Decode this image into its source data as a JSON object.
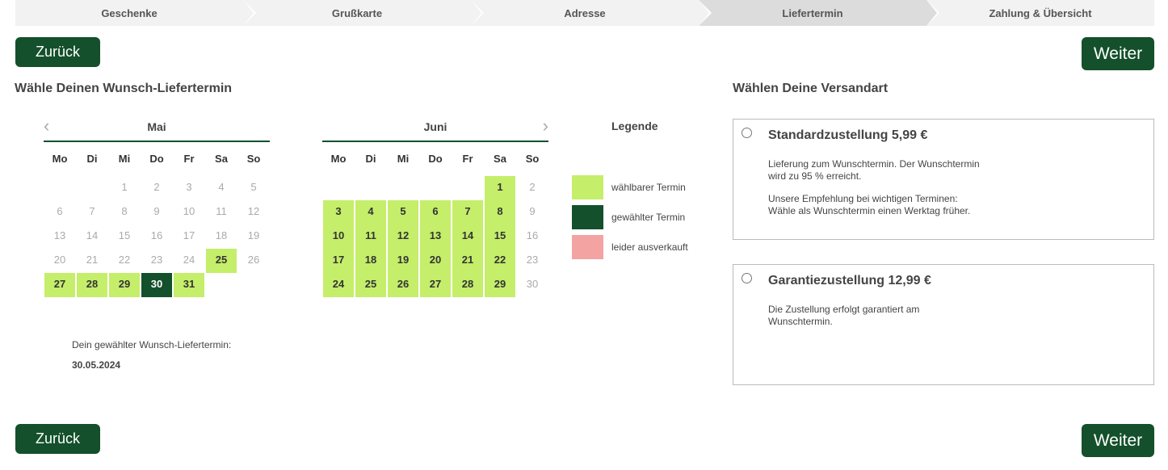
{
  "stepper": {
    "steps": [
      "Geschenke",
      "Grußkarte",
      "Adresse",
      "Liefertermin",
      "Zahlung & Übersicht"
    ],
    "active_index": 3
  },
  "buttons": {
    "back": "Zurück",
    "next": "Weiter"
  },
  "delivery_section_title": "Wähle Deinen Wunsch-Liefertermin",
  "shipping_section_title": "Wählen Deine Versandart",
  "weekdays": [
    "Mo",
    "Di",
    "Mi",
    "Do",
    "Fr",
    "Sa",
    "So"
  ],
  "calendar_may": {
    "month": "Mai",
    "rows": [
      [
        {
          "d": ""
        },
        {
          "d": ""
        },
        {
          "d": "1",
          "s": "off"
        },
        {
          "d": "2",
          "s": "off"
        },
        {
          "d": "3",
          "s": "off"
        },
        {
          "d": "4",
          "s": "off"
        },
        {
          "d": "5",
          "s": "off"
        }
      ],
      [
        {
          "d": "6",
          "s": "off"
        },
        {
          "d": "7",
          "s": "off"
        },
        {
          "d": "8",
          "s": "off"
        },
        {
          "d": "9",
          "s": "off"
        },
        {
          "d": "10",
          "s": "off"
        },
        {
          "d": "11",
          "s": "off"
        },
        {
          "d": "12",
          "s": "off"
        }
      ],
      [
        {
          "d": "13",
          "s": "off"
        },
        {
          "d": "14",
          "s": "off"
        },
        {
          "d": "15",
          "s": "off"
        },
        {
          "d": "16",
          "s": "off"
        },
        {
          "d": "17",
          "s": "off"
        },
        {
          "d": "18",
          "s": "off"
        },
        {
          "d": "19",
          "s": "off"
        }
      ],
      [
        {
          "d": "20",
          "s": "off"
        },
        {
          "d": "21",
          "s": "off"
        },
        {
          "d": "22",
          "s": "off"
        },
        {
          "d": "23",
          "s": "off"
        },
        {
          "d": "24",
          "s": "off"
        },
        {
          "d": "25",
          "s": "avail"
        },
        {
          "d": "26",
          "s": "off"
        }
      ],
      [
        {
          "d": "27",
          "s": "avail"
        },
        {
          "d": "28",
          "s": "avail"
        },
        {
          "d": "29",
          "s": "avail"
        },
        {
          "d": "30",
          "s": "sel"
        },
        {
          "d": "31",
          "s": "avail"
        },
        {
          "d": ""
        },
        {
          "d": ""
        }
      ]
    ]
  },
  "calendar_june": {
    "month": "Juni",
    "rows": [
      [
        {
          "d": ""
        },
        {
          "d": ""
        },
        {
          "d": ""
        },
        {
          "d": ""
        },
        {
          "d": ""
        },
        {
          "d": "1",
          "s": "avail"
        },
        {
          "d": "2",
          "s": "off"
        }
      ],
      [
        {
          "d": "3",
          "s": "avail"
        },
        {
          "d": "4",
          "s": "avail"
        },
        {
          "d": "5",
          "s": "avail"
        },
        {
          "d": "6",
          "s": "avail"
        },
        {
          "d": "7",
          "s": "avail"
        },
        {
          "d": "8",
          "s": "avail"
        },
        {
          "d": "9",
          "s": "off"
        }
      ],
      [
        {
          "d": "10",
          "s": "avail"
        },
        {
          "d": "11",
          "s": "avail"
        },
        {
          "d": "12",
          "s": "avail"
        },
        {
          "d": "13",
          "s": "avail"
        },
        {
          "d": "14",
          "s": "avail"
        },
        {
          "d": "15",
          "s": "avail"
        },
        {
          "d": "16",
          "s": "off"
        }
      ],
      [
        {
          "d": "17",
          "s": "avail"
        },
        {
          "d": "18",
          "s": "avail"
        },
        {
          "d": "19",
          "s": "avail"
        },
        {
          "d": "20",
          "s": "avail"
        },
        {
          "d": "21",
          "s": "avail"
        },
        {
          "d": "22",
          "s": "avail"
        },
        {
          "d": "23",
          "s": "off"
        }
      ],
      [
        {
          "d": "24",
          "s": "avail"
        },
        {
          "d": "25",
          "s": "avail"
        },
        {
          "d": "26",
          "s": "avail"
        },
        {
          "d": "27",
          "s": "avail"
        },
        {
          "d": "28",
          "s": "avail"
        },
        {
          "d": "29",
          "s": "avail"
        },
        {
          "d": "30",
          "s": "off"
        }
      ]
    ]
  },
  "nav_icons": {
    "prev": "chevron-left-icon",
    "next": "chevron-right-icon"
  },
  "legend": {
    "title": "Legende",
    "items": [
      {
        "label": "wählbarer Termin",
        "color": "#c5ee6a"
      },
      {
        "label": "gewählter Termin",
        "color": "#13502b"
      },
      {
        "label": "leider ausverkauft",
        "color": "#f4a3a3"
      }
    ]
  },
  "chosen_date": {
    "label": "Dein gewählter Wunsch-Liefertermin:",
    "value": "30.05.2024"
  },
  "shipping_options": {
    "standard": {
      "title": "Standardzustellung 5,99 €",
      "desc1_line1": "Lieferung zum Wunschtermin. Der Wunschtermin",
      "desc1_line2": "wird zu 95 % erreicht.",
      "desc2_line1": "Unsere Empfehlung bei wichtigen Terminen:",
      "desc2_line2": "Wähle als Wunschtermin einen Werktag früher."
    },
    "guarantee": {
      "title": "Garantiezustellung 12,99 €",
      "desc_line1": "Die Zustellung erfolgt garantiert am",
      "desc_line2": "Wunschtermin."
    }
  },
  "colors": {
    "brand_green": "#13502b",
    "available_green": "#c5ee6a",
    "sold_out": "#f4a3a3"
  }
}
